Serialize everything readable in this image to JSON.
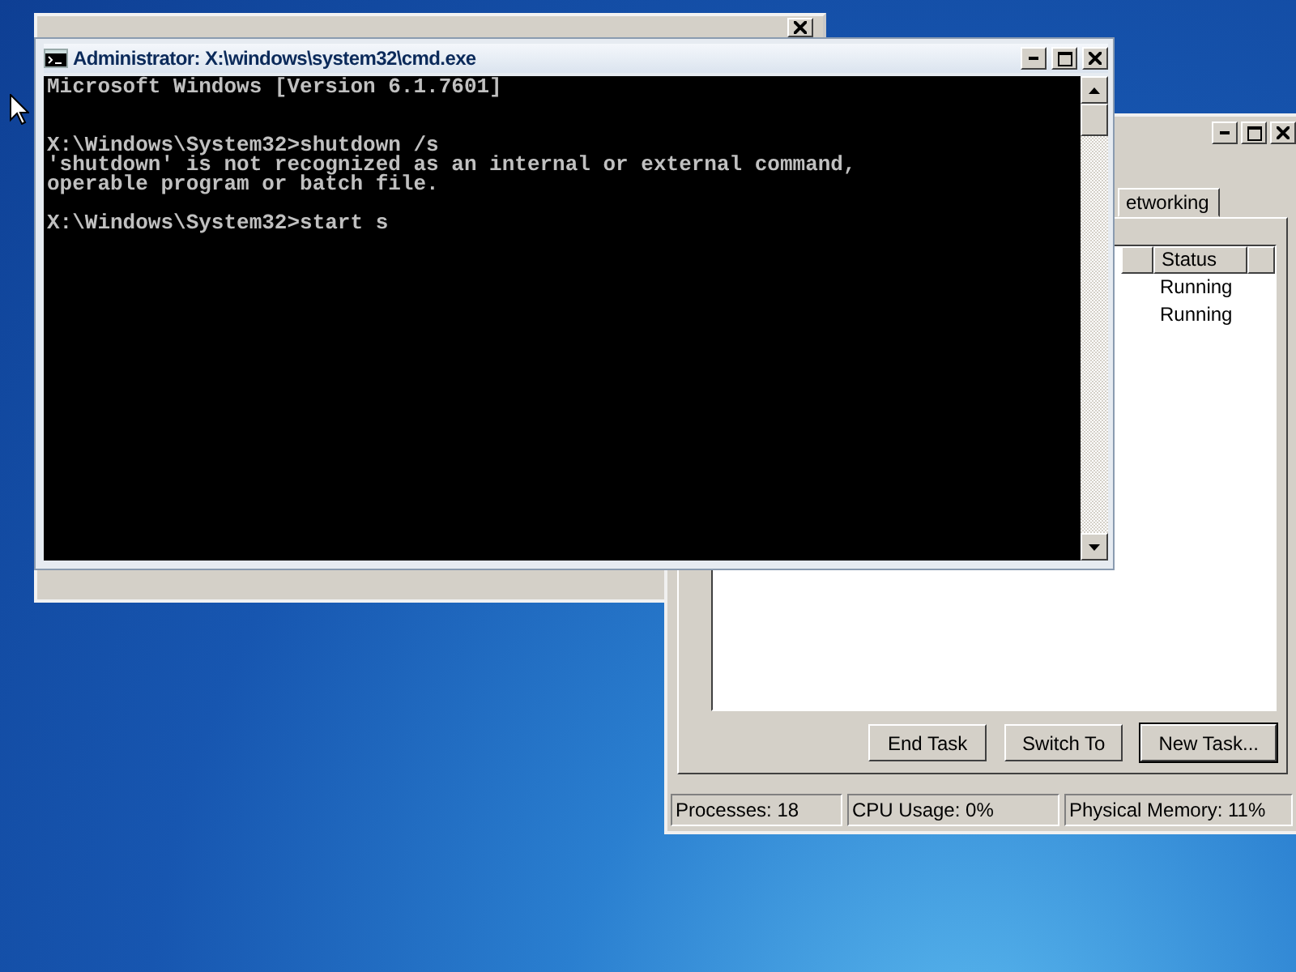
{
  "cmd_window": {
    "title": "Administrator: X:\\windows\\system32\\cmd.exe",
    "console": [
      {
        "kind": "line",
        "text": "Microsoft Windows [Version 6.1.7601]"
      },
      {
        "kind": "blank"
      },
      {
        "kind": "blank"
      },
      {
        "kind": "line",
        "text": "X:\\Windows\\System32>shutdown /s"
      },
      {
        "kind": "line",
        "text": "'shutdown' is not recognized as an internal or external command,"
      },
      {
        "kind": "line",
        "text": "operable program or batch file."
      },
      {
        "kind": "blank"
      },
      {
        "kind": "line",
        "text": "X:\\Windows\\System32>start s"
      }
    ]
  },
  "task_manager": {
    "tabs": [
      {
        "label": "etworking",
        "selected": false
      }
    ],
    "columns": [
      "Status"
    ],
    "rows": [
      {
        "status": "Running"
      },
      {
        "status": "Running"
      }
    ],
    "buttons": [
      {
        "label": "End Task",
        "default": false
      },
      {
        "label": "Switch To",
        "default": false
      },
      {
        "label": "New Task...",
        "default": true
      }
    ],
    "status_bar": [
      "Processes: 18",
      "CPU Usage: 0%",
      "Physical Memory: 11%"
    ]
  }
}
